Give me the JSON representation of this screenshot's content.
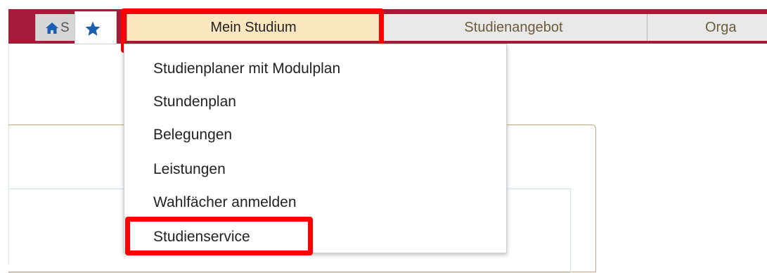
{
  "nav": {
    "home_label": "S",
    "tabs": [
      {
        "label": "Mein Studium"
      },
      {
        "label": "Studienangebot"
      },
      {
        "label": "Orga"
      }
    ]
  },
  "dropdown": {
    "items": [
      {
        "label": "Studienplaner mit Modulplan"
      },
      {
        "label": "Stundenplan"
      },
      {
        "label": "Belegungen"
      },
      {
        "label": "Leistungen"
      },
      {
        "label": "Wahlfächer anmelden"
      },
      {
        "label": "Studienservice"
      }
    ]
  },
  "colors": {
    "brand_bar": "#a51c3b",
    "active_tab": "#fbe7bf",
    "highlight": "#ff0000",
    "icon_blue": "#1a5fb4"
  },
  "icons": [
    "home-icon",
    "star-icon"
  ]
}
